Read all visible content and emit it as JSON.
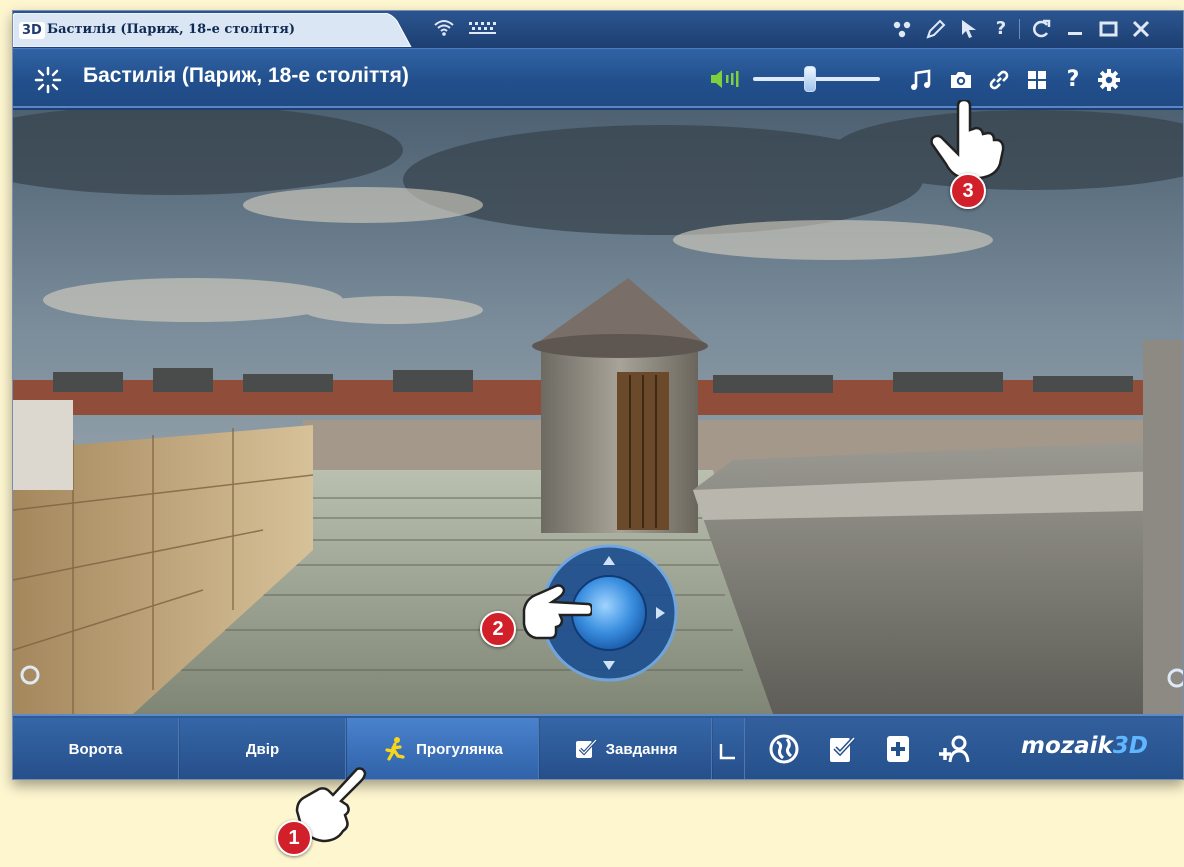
{
  "tabbar": {
    "logo": "3D",
    "tab_title": "Бастилія (Париж, 18-е століття)",
    "icons": [
      "network-icon",
      "pencil-icon",
      "pointer-icon",
      "help-icon",
      "refresh-icon",
      "minimize-icon",
      "maximize-icon",
      "close-icon"
    ],
    "help_glyph": "?"
  },
  "header": {
    "title": "Бастилія (Париж, 18-е століття)",
    "volume_level": 0.45,
    "icons": [
      "volume-icon",
      "music-icon",
      "camera-icon",
      "link-icon",
      "grid-icon",
      "help-icon",
      "settings-icon"
    ],
    "help_glyph": "?"
  },
  "bottom": {
    "tabs": [
      {
        "label": "Ворота",
        "active": false
      },
      {
        "label": "Двір",
        "active": false
      },
      {
        "label": "Прогулянка",
        "active": true
      },
      {
        "label": "Завдання",
        "active": false
      }
    ],
    "tools": [
      "globe-icon",
      "checklist-icon",
      "add-page-icon",
      "add-user-icon"
    ],
    "brand_main": "mozaik",
    "brand_accent": "3D"
  },
  "annotations": [
    "1",
    "2",
    "3"
  ],
  "colors": {
    "accent": "#d2202a",
    "bar": "#1f4a84",
    "page": "#fdf6cf"
  }
}
